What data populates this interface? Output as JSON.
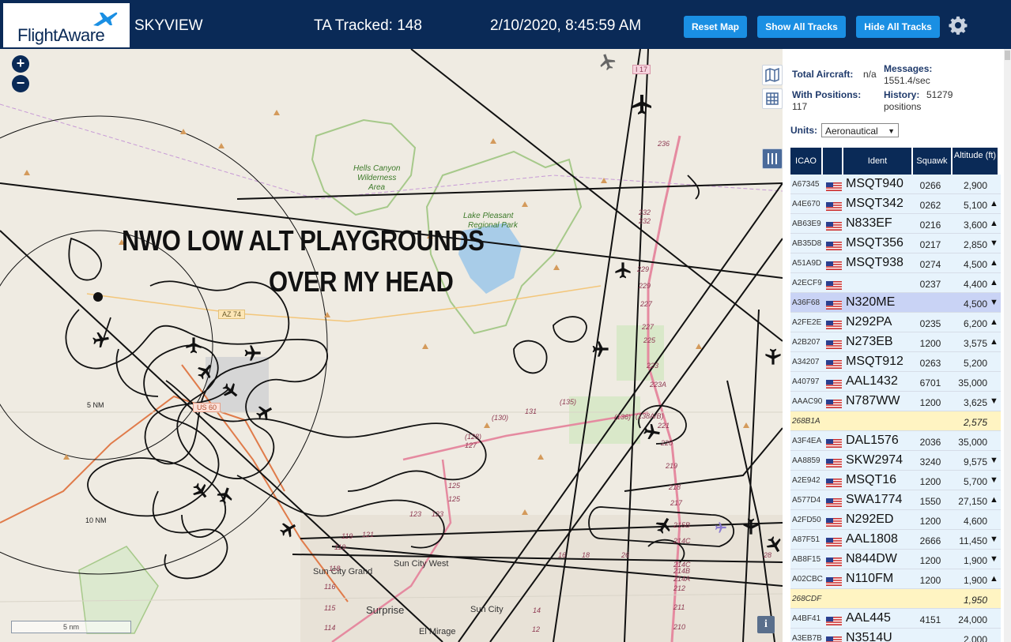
{
  "header": {
    "logo_text": "FlightAware",
    "app_title": "SKYVIEW",
    "ta_tracked": "TA Tracked: 148",
    "clock": "2/10/2020, 8:45:59 AM",
    "buttons": {
      "reset": "Reset Map",
      "show_all": "Show All Tracks",
      "hide_all": "Hide All Tracks"
    }
  },
  "map": {
    "overlay_line1": "NWO LOW ALT PLAYGROUNDS",
    "overlay_line2": "OVER MY HEAD",
    "labels": {
      "hells_canyon": "Hells Canyon",
      "wilderness": "Wilderness",
      "area": "Area",
      "lake_pleasant": "Lake Pleasant",
      "regional_park": "Regional Park",
      "ring_5": "5 NM",
      "ring_10": "10 NM",
      "us60": "US 60",
      "az74": "AZ 74",
      "i17": "I 17",
      "sun_city_grand": "Sun City Grand",
      "sun_city_west": "Sun City West",
      "surprise": "Surprise",
      "sun_city": "Sun City",
      "el_mirage": "El Mirage"
    },
    "exits": [
      "236",
      "232",
      "232",
      "229",
      "229",
      "227",
      "227",
      "225",
      "223",
      "223A",
      "221",
      "220",
      "219",
      "218",
      "217",
      "215B",
      "214C",
      "214C",
      "214B",
      "214A",
      "212",
      "211",
      "210",
      "131",
      "(130)",
      "(128)",
      "127",
      "125",
      "125",
      "123",
      "123",
      "121",
      "119",
      "119",
      "118",
      "116",
      "115",
      "114",
      "12",
      "14",
      "16",
      "18",
      "(135)",
      "(136)",
      "(138A/B)",
      "26",
      "28"
    ],
    "scale_label": "5 nm",
    "zoom_in": "+",
    "zoom_out": "−",
    "info": "i"
  },
  "panel": {
    "total_aircraft_label": "Total Aircraft:",
    "total_aircraft_value": "n/a",
    "with_positions_label": "With Positions:",
    "with_positions_value": "117",
    "messages_label": "Messages:",
    "messages_value": "1551.4/sec",
    "history_label": "History:",
    "history_value": "51279",
    "history_unit": "positions",
    "units_label": "Units:",
    "units_value": "Aeronautical",
    "columns": [
      "ICAO",
      "Ident",
      "Squawk",
      "Altitude (ft)"
    ],
    "rows": [
      {
        "icao": "A67345",
        "ident": "MSQT940",
        "squawk": "0266",
        "alt": "2,900",
        "trend": "",
        "flag": true,
        "hl": "none"
      },
      {
        "icao": "A4E670",
        "ident": "MSQT342",
        "squawk": "0262",
        "alt": "5,100",
        "trend": "▲",
        "flag": true,
        "hl": "none"
      },
      {
        "icao": "AB63E9",
        "ident": "N833EF",
        "squawk": "0216",
        "alt": "3,600",
        "trend": "▲",
        "flag": true,
        "hl": "none"
      },
      {
        "icao": "AB35D8",
        "ident": "MSQT356",
        "squawk": "0217",
        "alt": "2,850",
        "trend": "▼",
        "flag": true,
        "hl": "none"
      },
      {
        "icao": "A51A9D",
        "ident": "MSQT938",
        "squawk": "0274",
        "alt": "4,500",
        "trend": "▲",
        "flag": true,
        "hl": "none"
      },
      {
        "icao": "A2ECF9",
        "ident": "",
        "squawk": "0237",
        "alt": "4,400",
        "trend": "▲",
        "flag": true,
        "hl": "none"
      },
      {
        "icao": "A36F68",
        "ident": "N320ME",
        "squawk": "",
        "alt": "4,500",
        "trend": "▼",
        "flag": true,
        "hl": "selected"
      },
      {
        "icao": "A2FE2E",
        "ident": "N292PA",
        "squawk": "0235",
        "alt": "6,200",
        "trend": "▲",
        "flag": true,
        "hl": "none"
      },
      {
        "icao": "A2B207",
        "ident": "N273EB",
        "squawk": "1200",
        "alt": "3,575",
        "trend": "▲",
        "flag": true,
        "hl": "none"
      },
      {
        "icao": "A34207",
        "ident": "MSQT912",
        "squawk": "0263",
        "alt": "5,200",
        "trend": "",
        "flag": true,
        "hl": "none"
      },
      {
        "icao": "A40797",
        "ident": "AAL1432",
        "squawk": "6701",
        "alt": "35,000",
        "trend": "",
        "flag": true,
        "hl": "none"
      },
      {
        "icao": "AAAC90",
        "ident": "N787WW",
        "squawk": "1200",
        "alt": "3,625",
        "trend": "▼",
        "flag": true,
        "hl": "none"
      },
      {
        "icao": "268B1A",
        "ident": "",
        "squawk": "",
        "alt": "2,575",
        "trend": "",
        "flag": false,
        "hl": "tisb"
      },
      {
        "icao": "A3F4EA",
        "ident": "DAL1576",
        "squawk": "2036",
        "alt": "35,000",
        "trend": "",
        "flag": true,
        "hl": "none"
      },
      {
        "icao": "AA8859",
        "ident": "SKW2974",
        "squawk": "3240",
        "alt": "9,575",
        "trend": "▼",
        "flag": true,
        "hl": "none"
      },
      {
        "icao": "A2E942",
        "ident": "MSQT16",
        "squawk": "1200",
        "alt": "5,700",
        "trend": "▼",
        "flag": true,
        "hl": "none"
      },
      {
        "icao": "A577D4",
        "ident": "SWA1774",
        "squawk": "1550",
        "alt": "27,150",
        "trend": "▲",
        "flag": true,
        "hl": "none"
      },
      {
        "icao": "A2FD50",
        "ident": "N292ED",
        "squawk": "1200",
        "alt": "4,600",
        "trend": "",
        "flag": true,
        "hl": "none"
      },
      {
        "icao": "A87F51",
        "ident": "AAL1808",
        "squawk": "2666",
        "alt": "11,450",
        "trend": "▼",
        "flag": true,
        "hl": "none"
      },
      {
        "icao": "AB8F15",
        "ident": "N844DW",
        "squawk": "1200",
        "alt": "1,900",
        "trend": "▼",
        "flag": true,
        "hl": "none"
      },
      {
        "icao": "A02CBC",
        "ident": "N110FM",
        "squawk": "1200",
        "alt": "1,900",
        "trend": "▲",
        "flag": true,
        "hl": "none"
      },
      {
        "icao": "268CDF",
        "ident": "",
        "squawk": "",
        "alt": "1,950",
        "trend": "",
        "flag": false,
        "hl": "tisb"
      },
      {
        "icao": "A4BF41",
        "ident": "AAL445",
        "squawk": "4151",
        "alt": "24,000",
        "trend": "",
        "flag": true,
        "hl": "none"
      },
      {
        "icao": "A3EB7B",
        "ident": "N3514U",
        "squawk": "",
        "alt": "2,000",
        "trend": "",
        "flag": true,
        "hl": "none"
      }
    ]
  },
  "colors": {
    "header_bg": "#0a2a57",
    "button_bg": "#1a8fe3",
    "row_bg": "#e7f3fc",
    "row_selected": "#c9d3f5",
    "row_tisb": "#fff4c2",
    "map_bg": "#efebe2",
    "track": "#111111",
    "freeway": "#e58aa0",
    "park": "#a6c98a"
  }
}
